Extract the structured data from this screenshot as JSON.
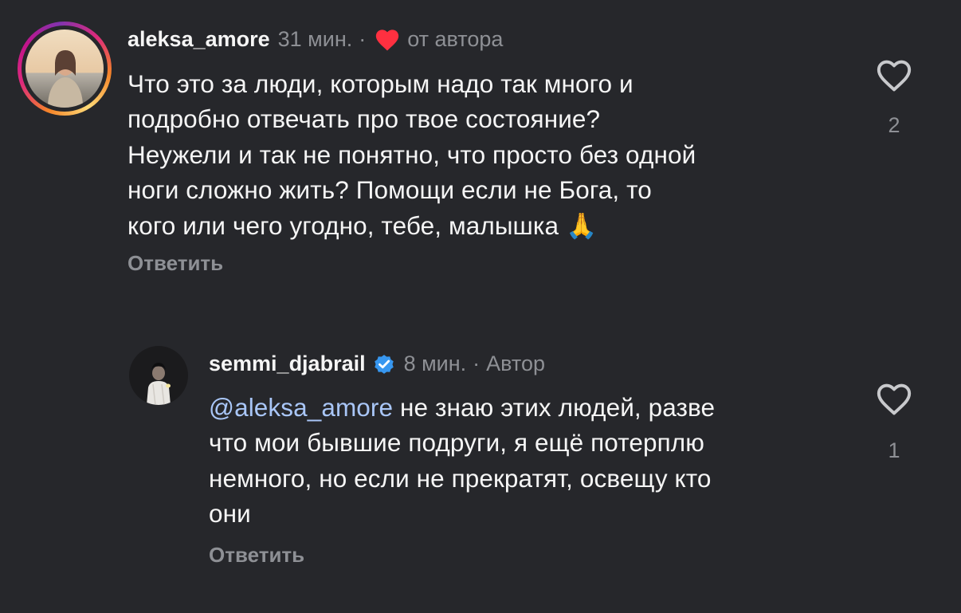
{
  "comments": [
    {
      "username": "aleksa_amore",
      "time": "31 мин.",
      "separator": "·",
      "author_liked_label": "от автора",
      "lines": [
        "Что это за люди, которым надо так много и",
        "подробно отвечать про твое состояние?",
        "Неужели и так не понятно, что просто без одной",
        "ноги сложно жить? Помощи если не Бога, то",
        "кого или чего угодно, тебе, малышка"
      ],
      "emoji": "🙏",
      "reply_label": "Ответить",
      "likes": "2",
      "icons": {
        "avatar": "story-ring-avatar",
        "author_like": "heart-filled-icon",
        "like": "heart-outline-icon"
      },
      "colors": {
        "author_heart": "#ff3040"
      }
    },
    {
      "username": "semmi_djabrail",
      "verified": true,
      "time": "8 мин.",
      "separator": "·",
      "author_badge": "Автор",
      "mention": "@aleksa_amore",
      "text_first": " не знаю этих людей, разве",
      "lines": [
        "что мои бывшие подруги, я ещё потерплю",
        "немного, но если не прекратят, освещу кто",
        "они"
      ],
      "reply_label": "Ответить",
      "likes": "1",
      "icons": {
        "verified": "verified-badge-icon",
        "like": "heart-outline-icon"
      },
      "colors": {
        "verified": "#3797f0",
        "mention": "#a9c6f7"
      }
    }
  ],
  "theme": {
    "background": "#26272b",
    "text": "#f5f5f5",
    "muted": "#8e9095"
  }
}
